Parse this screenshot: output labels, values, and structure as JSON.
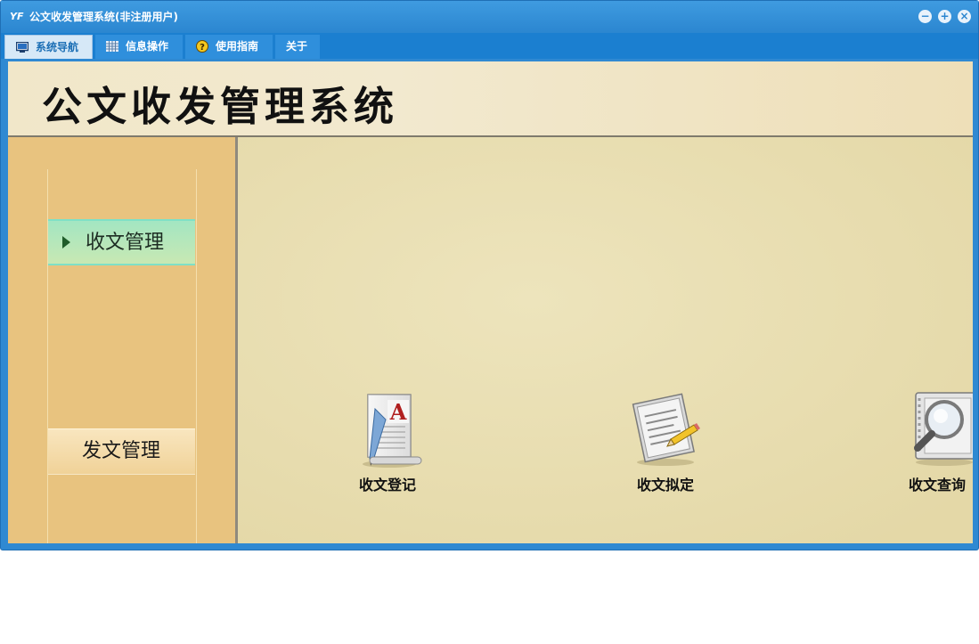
{
  "window": {
    "title": "公文收发管理系统(非注册用户)",
    "app_icon": "yf-logo-icon",
    "controls": [
      "minimize-icon",
      "maximize-icon",
      "close-icon"
    ]
  },
  "menu": {
    "tabs": [
      {
        "label": "系统导航",
        "icon": "monitor-icon",
        "active": true
      },
      {
        "label": "信息操作",
        "icon": "grid-icon",
        "active": false
      },
      {
        "label": "使用指南",
        "icon": "help-icon",
        "active": false
      },
      {
        "label": "关于",
        "active": false
      }
    ]
  },
  "banner": {
    "title": "公文收发管理系统"
  },
  "sidebar": {
    "items": [
      {
        "label": "收文管理",
        "active": true
      },
      {
        "label": "发文管理",
        "active": false
      }
    ]
  },
  "main": {
    "tiles": [
      {
        "label": "收文登记",
        "icon": "document-letter-a-icon"
      },
      {
        "label": "收文拟定",
        "icon": "document-pencil-icon"
      },
      {
        "label": "收文查询",
        "icon": "document-search-icon"
      }
    ]
  },
  "colors": {
    "titlebar": "#2b86d0",
    "menubar": "#1b7fd0",
    "sidebar": "#e8c37f",
    "content": "#ece0b4",
    "active_nav": "#a3e6c2"
  }
}
